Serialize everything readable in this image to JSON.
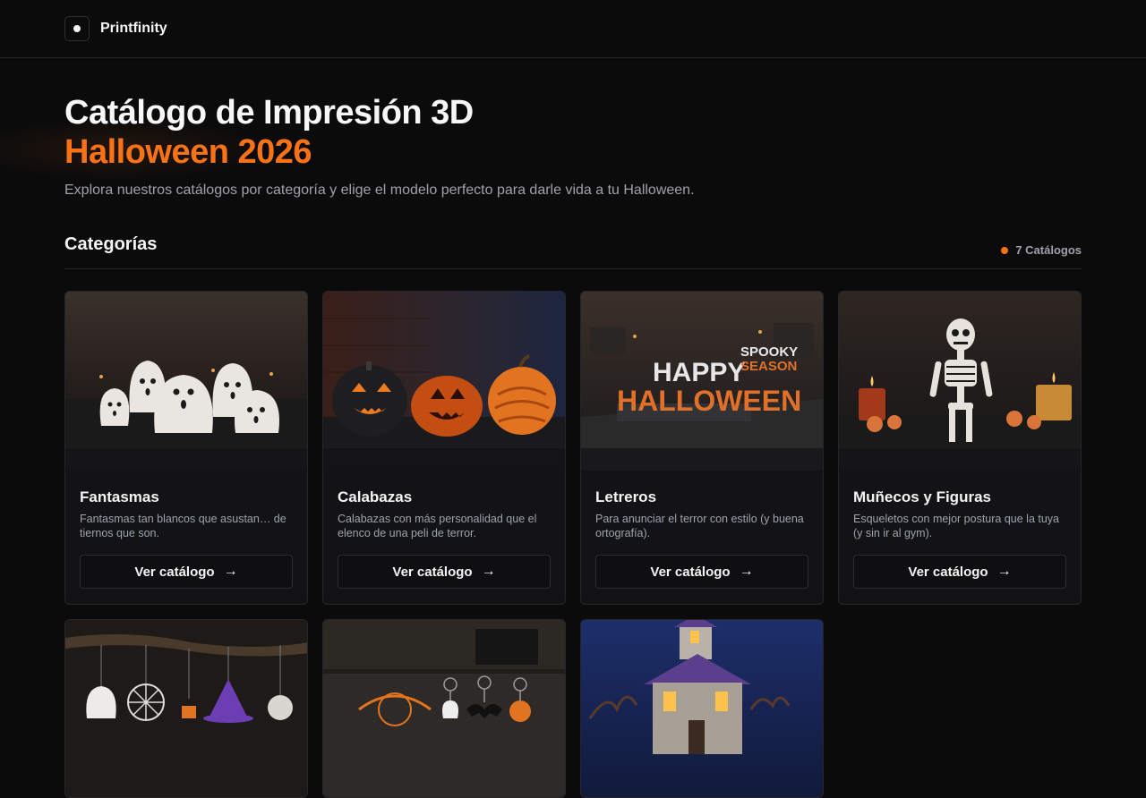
{
  "brand": {
    "name": "Printfinity"
  },
  "hero": {
    "title": "Catálogo de Impresión 3D",
    "title_accent": "Halloween 2026",
    "subtitle": "Explora nuestros catálogos por categoría y elige el modelo perfecto para darle vida a tu Halloween."
  },
  "section": {
    "title": "Categorías",
    "count_label": "7 Catálogos"
  },
  "colors": {
    "accent": "#f97316",
    "background": "#0b0b0c",
    "card": "#131316"
  },
  "cards": [
    {
      "title": "Fantasmas",
      "desc": "Fantasmas tan blancos que asustan… de tiernos que son.",
      "button": "Ver catálogo",
      "arrow": "→"
    },
    {
      "title": "Calabazas",
      "desc": "Calabazas con más personalidad que el elenco de una peli de terror.",
      "button": "Ver catálogo",
      "arrow": "→"
    },
    {
      "title": "Letreros",
      "desc": "Para anunciar el terror con estilo (y buena ortografía).",
      "button": "Ver catálogo",
      "arrow": "→",
      "image_text": {
        "sign_line1": "HAPPY",
        "sign_line2": "HALLOWEEN",
        "badge_line1": "SPOOKY",
        "badge_line2": "SEASON"
      }
    },
    {
      "title": "Muñecos y Figuras",
      "desc": "Esqueletos con mejor postura que la tuya (y sin ir al gym).",
      "button": "Ver catálogo",
      "arrow": "→"
    }
  ]
}
